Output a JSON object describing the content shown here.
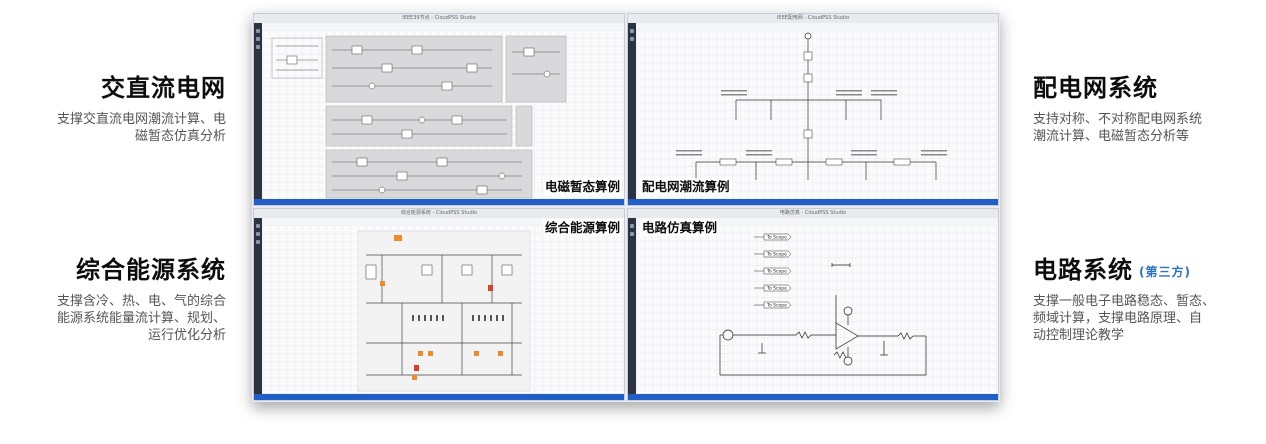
{
  "left_panels": [
    {
      "title": "交直流电网",
      "lines": [
        "支撑交直流电网潮流计算、电",
        "磁暂态仿真分析"
      ]
    },
    {
      "title": "综合能源系统",
      "lines": [
        "支撑含冷、热、电、气的综合",
        "能源系统能量流计算、规划、",
        "运行优化分析"
      ]
    }
  ],
  "right_panels": [
    {
      "title": "配电网系统",
      "tag": "",
      "lines": [
        "支持对称、不对称配电网系统",
        "潮流计算、电磁暂态分析等"
      ]
    },
    {
      "title": "电路系统",
      "tag": "(第三方)",
      "lines": [
        "支撑一般电子电路稳态、暂态、",
        "频域计算，支撑电路原理、自",
        "动控制理论教学"
      ]
    }
  ],
  "screenshots": [
    {
      "label": "电磁暂态算例",
      "window_title": "IEEE39节点 - CloudPSS Studio"
    },
    {
      "label": "配电网潮流算例",
      "window_title": "IEEE配电网 - CloudPSS Studio"
    },
    {
      "label": "综合能源算例",
      "window_title": "综合能源系统 - CloudPSS Studio"
    },
    {
      "label": "电路仿真算例",
      "window_title": "电路仿真 - CloudPSS Studio"
    }
  ],
  "circuit_scopes": [
    "To Scope",
    "To Scope",
    "To Scope",
    "To Scope",
    "To Scope"
  ],
  "colors": {
    "statusbar": "#1f5fc7",
    "leftbar": "#2b3440",
    "tag": "#2f6fc4",
    "highlight": "#f08a2a",
    "alert": "#e03c2c"
  }
}
